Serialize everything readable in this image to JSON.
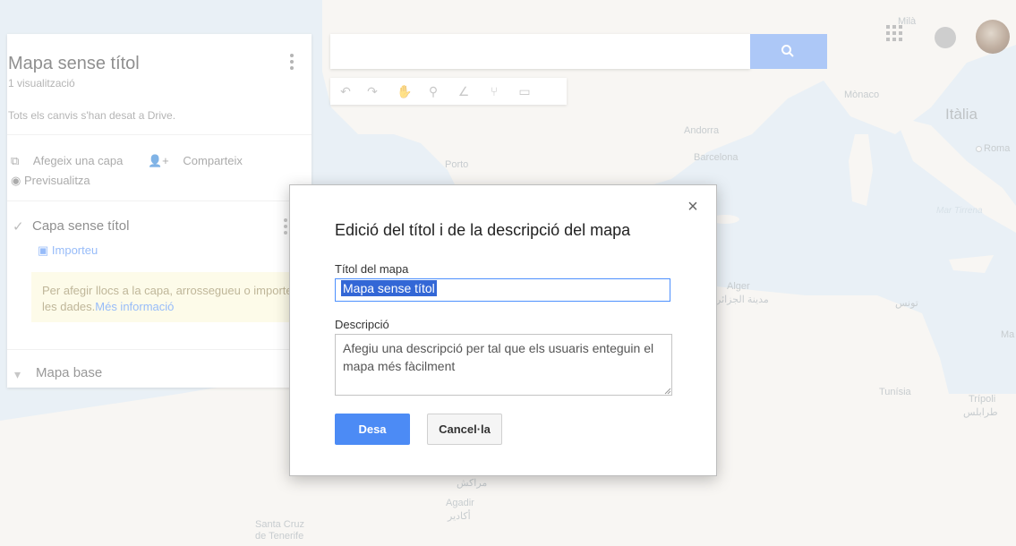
{
  "map": {
    "labels": {
      "mila": "Milà",
      "monaco": "Mònaco",
      "italia": "Itàlia",
      "roma": "Roma",
      "andorra": "Andorra",
      "barcelona": "Barcelona",
      "porto": "Porto",
      "mar_tirrena": "Mar Tirrena",
      "alger": "Alger",
      "alger_ar": "مدينة الجزائر",
      "tunis_ar": "تونس",
      "ma": "Ma",
      "tunisia": "Tunísia",
      "tripoli": "Trípoli",
      "tripoli_ar": "طرابلس",
      "marrakesh_ar": "مراكش",
      "agadir": "Agadir",
      "agadir_ar": "أكادير",
      "santa_cruz": "Santa Cruz",
      "de_tenerife": "de Tenerife"
    }
  },
  "left_panel": {
    "title": "Mapa sense títol",
    "views": "1 visualització",
    "saved_status": "Tots els canvis s'han desat a Drive.",
    "add_layer": "Afegeix una capa",
    "share": "Comparteix",
    "preview": "Previsualitza",
    "layer": {
      "title": "Capa sense títol",
      "import": "Importeu",
      "hint": "Per afegir llocs a la capa, arrossegueu o importeu les dades.",
      "hint_link": "Més informació"
    },
    "base_map": "Mapa base"
  },
  "dialog": {
    "title": "Edició del títol i de la descripció del mapa",
    "title_label": "Títol del mapa",
    "title_value": "Mapa sense títol",
    "description_label": "Descripció",
    "description_placeholder": "Afegiu una descripció per tal que els usuaris enteguin el mapa més fàcilment",
    "save": "Desa",
    "cancel": "Cancel·la",
    "close_symbol": "×"
  }
}
